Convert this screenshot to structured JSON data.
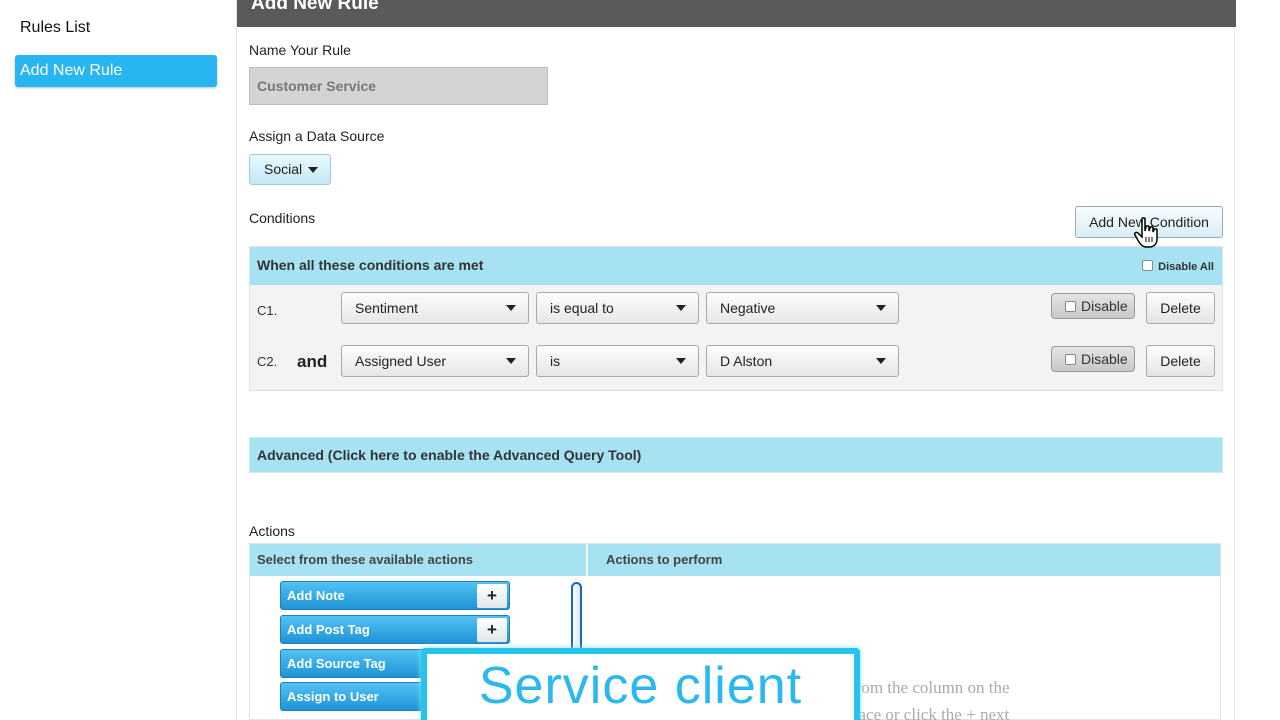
{
  "sidebar": {
    "rules_list": "Rules List",
    "add_new_rule": "Add New Rule"
  },
  "header": {
    "title": "Add New Rule"
  },
  "form": {
    "name_label": "Name Your Rule",
    "name_value": "Customer Service",
    "datasource_label": "Assign a Data Source",
    "datasource_value": "Social",
    "conditions_label": "Conditions",
    "add_condition_button": "Add New Condition"
  },
  "conditions": {
    "header": "When all these conditions are met",
    "disable_all": "Disable All",
    "rows": [
      {
        "id": "C1.",
        "connector": "",
        "field": "Sentiment",
        "operator": "is equal to",
        "value": "Negative",
        "disable": "Disable",
        "delete": "Delete"
      },
      {
        "id": "C2.",
        "connector": "and",
        "field": "Assigned User",
        "operator": "is",
        "value": "D Alston",
        "disable": "Disable",
        "delete": "Delete"
      }
    ]
  },
  "advanced": {
    "label": "Advanced (Click here to enable the Advanced Query Tool)"
  },
  "actions": {
    "label": "Actions",
    "available_header": "Select from these available actions",
    "perform_header": "Actions to perform",
    "items": [
      "Add Note",
      "Add Post Tag",
      "Add Source Tag",
      "Assign to User"
    ],
    "plus": "+",
    "hint_line1": "from the column on the",
    "hint_line2": "pace or click the + next"
  },
  "caption": {
    "text": "Service client"
  },
  "colors": {
    "accent": "#27b6f2",
    "header_bg": "#5a5a5a",
    "section_bg": "#a6e2f1"
  },
  "icons": {
    "cursor": "hand-pointer-icon",
    "dropdown": "caret-down-icon",
    "add": "plus-icon"
  }
}
